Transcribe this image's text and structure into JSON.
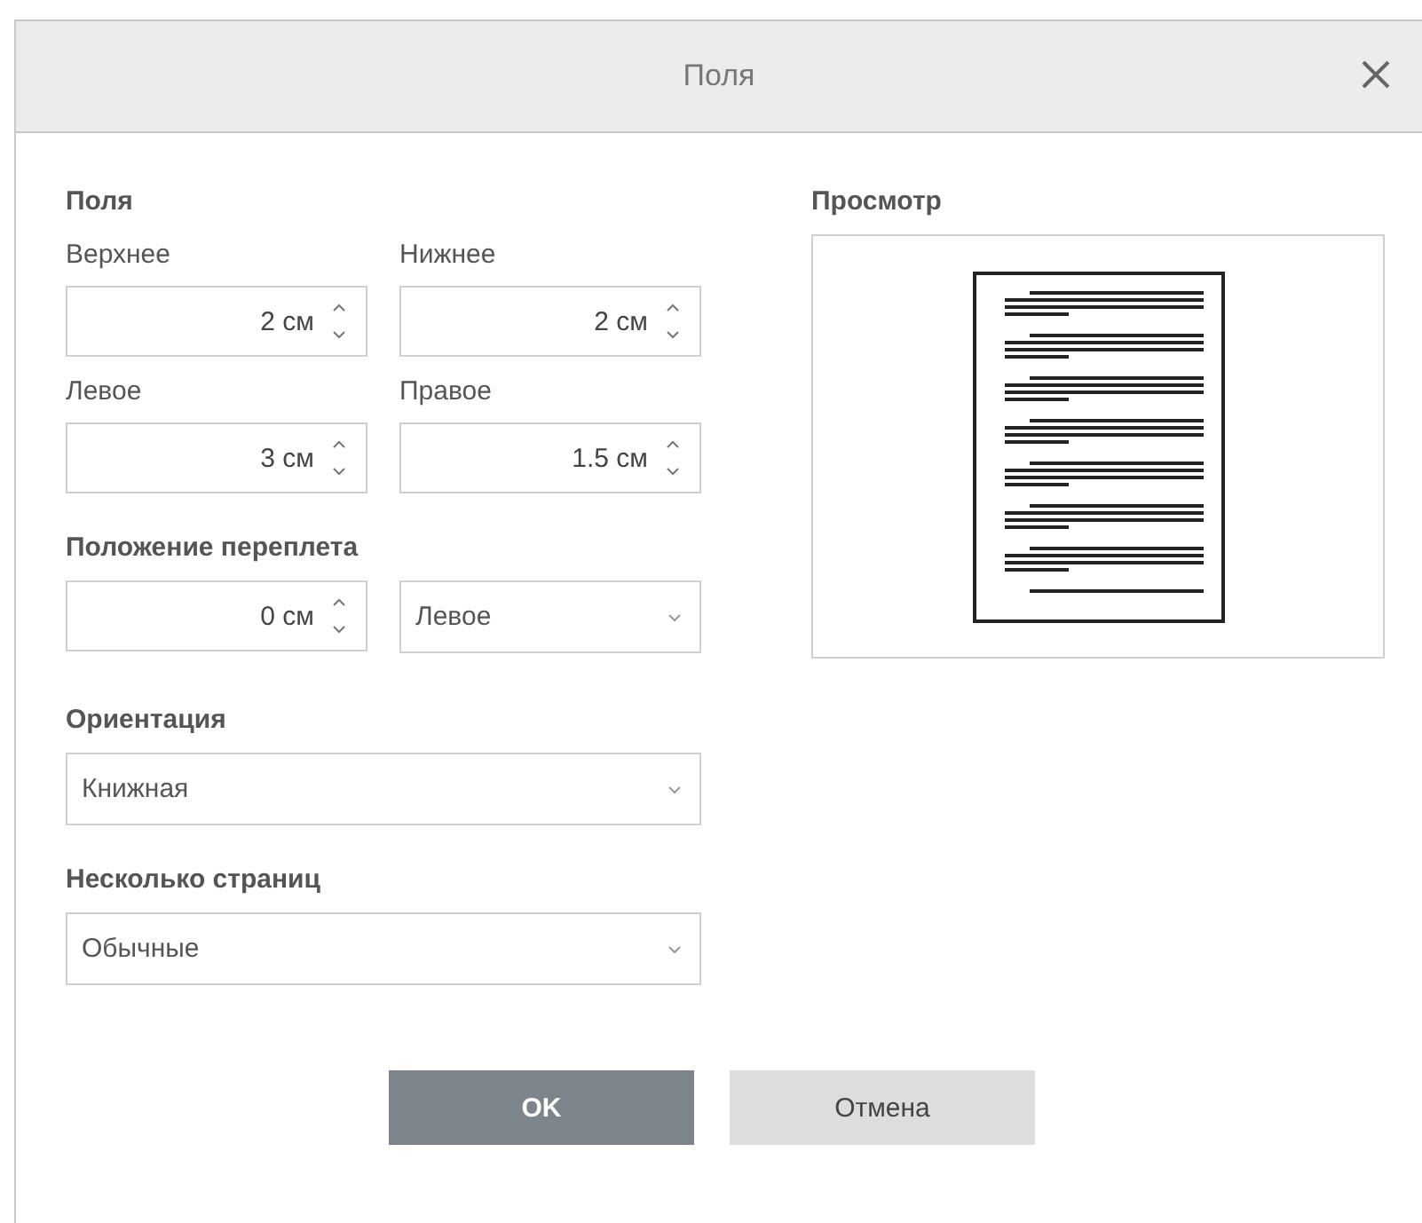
{
  "window": {
    "title": "Поля"
  },
  "margins": {
    "heading": "Поля",
    "fields": [
      {
        "label": "Верхнее",
        "value": "2 см"
      },
      {
        "label": "Нижнее",
        "value": "2 см"
      },
      {
        "label": "Левое",
        "value": "3 см"
      },
      {
        "label": "Правое",
        "value": "1.5 см"
      }
    ]
  },
  "gutter": {
    "heading": "Положение переплета",
    "value": "0 см",
    "position": "Левое"
  },
  "orientation": {
    "heading": "Ориентация",
    "value": "Книжная"
  },
  "multiple_pages": {
    "heading": "Несколько страниц",
    "value": "Обычные"
  },
  "preview": {
    "heading": "Просмотр"
  },
  "buttons": [
    {
      "label": "OK",
      "kind": "primary"
    },
    {
      "label": "Отмена",
      "kind": "secondary"
    }
  ]
}
